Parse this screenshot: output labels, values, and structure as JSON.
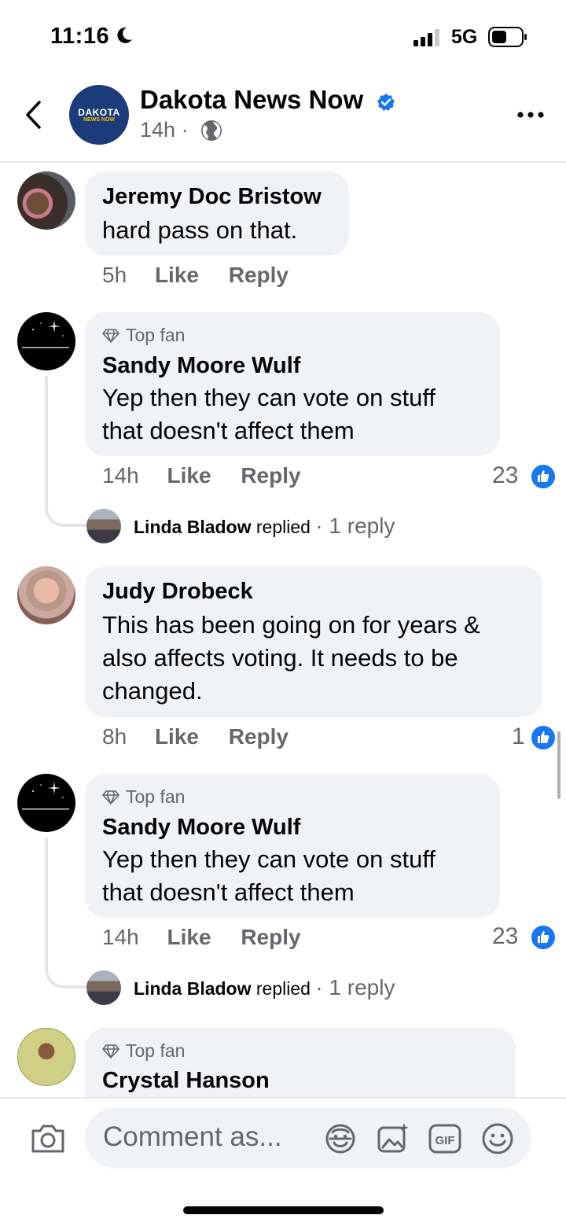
{
  "status_bar": {
    "time": "11:16",
    "network": "5G"
  },
  "header": {
    "page_name": "Dakota News Now",
    "time_ago": "14h",
    "separator": "·",
    "logo_text": "DAKOTA",
    "logo_sub": "NEWS NOW"
  },
  "comments": [
    {
      "author": "Jeremy Doc Bristow",
      "text": "hard pass on that.",
      "time": "5h",
      "like": "Like",
      "reply": "Reply"
    },
    {
      "badge": "Top fan",
      "author": "Sandy Moore Wulf",
      "lines": [
        "Yep then they can vote on stuff",
        "that doesn't affect them"
      ],
      "time": "14h",
      "like": "Like",
      "reply": "Reply",
      "reactions": "23",
      "replied": {
        "name": "Linda Bladow",
        "verb": "replied",
        "count": "· 1 reply"
      }
    },
    {
      "author": "Judy Drobeck",
      "lines": [
        "This has been going on for years &",
        "also affects voting. It needs to be",
        "changed."
      ],
      "time": "8h",
      "like": "Like",
      "reply": "Reply",
      "reactions": "1"
    },
    {
      "badge": "Top fan",
      "author": "Sandy Moore Wulf",
      "lines": [
        "Yep then they can vote on stuff",
        "that doesn't affect them"
      ],
      "time": "14h",
      "like": "Like",
      "reply": "Reply",
      "reactions": "23",
      "replied": {
        "name": "Linda Bladow",
        "verb": "replied",
        "count": "· 1 reply"
      }
    },
    {
      "badge": "Top fan",
      "author": "Crystal Hanson"
    }
  ],
  "composer": {
    "placeholder": "Comment as..."
  },
  "colors": {
    "accent": "#1877f2",
    "bubble": "#f0f2f5",
    "secondary_text": "#65676b"
  },
  "icons": [
    "moon-icon",
    "signal-icon",
    "battery-icon",
    "back-arrow-icon",
    "verified-icon",
    "globe-icon",
    "more-icon",
    "diamond-icon",
    "like-icon",
    "camera-icon",
    "avatar-frame-icon",
    "photo-icon",
    "gif-icon",
    "emoji-icon"
  ]
}
